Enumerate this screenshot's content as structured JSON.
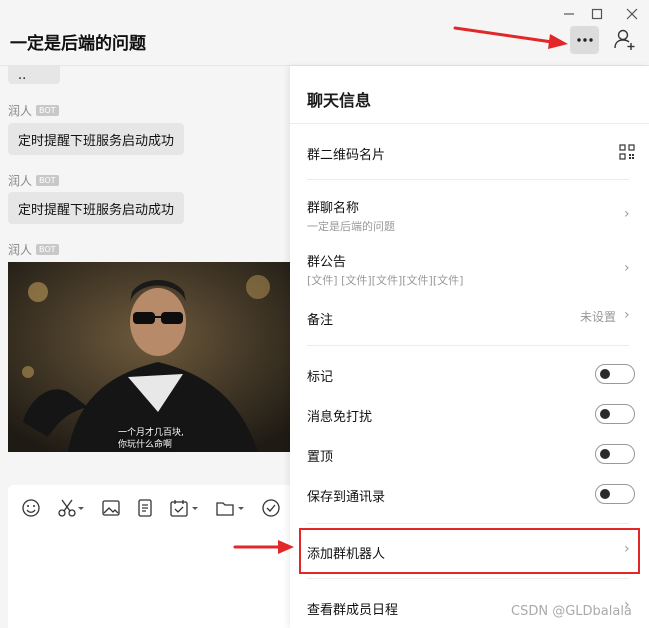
{
  "header": {
    "title": "一定是后端的问题"
  },
  "chat": {
    "top_bubble": "..",
    "messages": [
      {
        "sender": "润人",
        "tag": "BOT",
        "text": "定时提醒下班服务启动成功"
      },
      {
        "sender": "润人",
        "tag": "BOT",
        "text": "定时提醒下班服务启动成功"
      },
      {
        "sender": "润人",
        "tag": "BOT"
      }
    ],
    "image_caption": [
      "一个月才几百块,",
      "你玩什么命啊"
    ]
  },
  "panel": {
    "title": "聊天信息",
    "qr_label": "群二维码名片",
    "group_name_label": "群聊名称",
    "group_name_value": "一定是后端的问题",
    "notice_label": "群公告",
    "notice_value": "[文件] [文件][文件][文件][文件]",
    "remark_label": "备注",
    "remark_value": "未设置",
    "toggles": [
      {
        "label": "标记",
        "on": false
      },
      {
        "label": "消息免打扰",
        "on": false
      },
      {
        "label": "置顶",
        "on": false
      },
      {
        "label": "保存到通讯录",
        "on": false
      }
    ],
    "add_bot_label": "添加群机器人",
    "schedule_label": "查看群成员日程"
  },
  "watermark": "CSDN @GLDbalala",
  "colors": {
    "highlight": "#e12727",
    "bubble": "#e6e6e6",
    "panel_bg": "#ffffff"
  }
}
